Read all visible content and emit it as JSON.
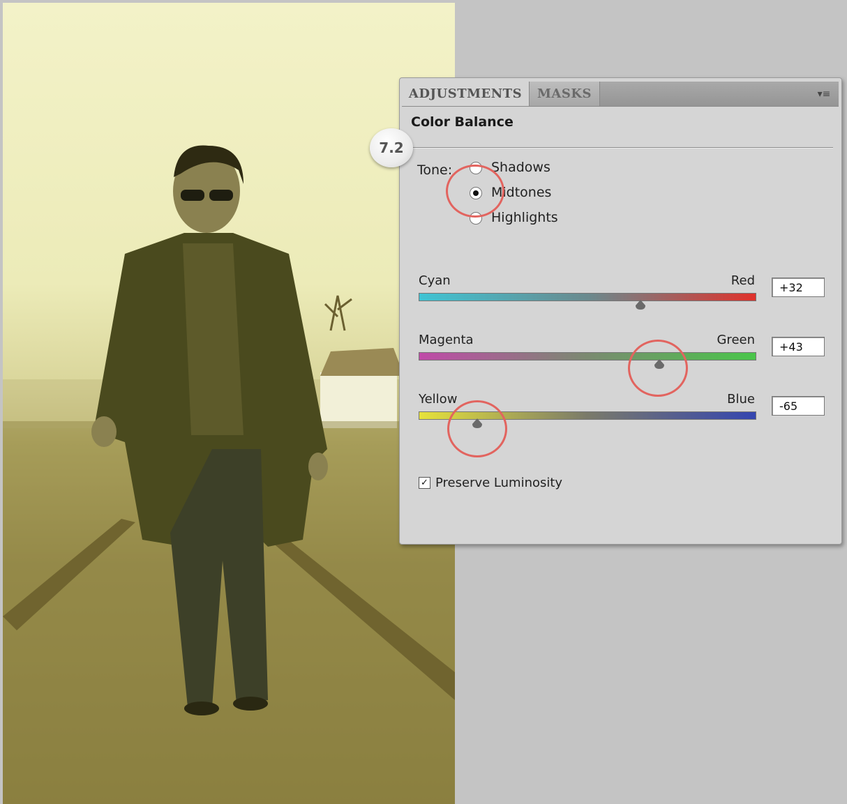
{
  "panel": {
    "tabs": [
      {
        "label": "ADJUSTMENTS",
        "active": true
      },
      {
        "label": "MASKS",
        "active": false
      }
    ],
    "menu_icon": "panel-menu-icon",
    "title": "Color Balance",
    "step_badge": "7.2"
  },
  "tone": {
    "label": "Tone:",
    "options": [
      {
        "label": "Shadows",
        "selected": false
      },
      {
        "label": "Midtones",
        "selected": true
      },
      {
        "label": "Highlights",
        "selected": false
      }
    ]
  },
  "sliders": [
    {
      "left": "Cyan",
      "right": "Red",
      "value": "+32",
      "numeric": 32,
      "gradient": [
        "#3fc4d4",
        "#6a8a8e",
        "#e0322c"
      ]
    },
    {
      "left": "Magenta",
      "right": "Green",
      "value": "+43",
      "numeric": 43,
      "gradient": [
        "#c04aa8",
        "#7a8a70",
        "#49c64a"
      ]
    },
    {
      "left": "Yellow",
      "right": "Blue",
      "value": "-65",
      "numeric": -65,
      "gradient": [
        "#e6e23a",
        "#7a7a6a",
        "#3445b0"
      ]
    }
  ],
  "preserve_luminosity": {
    "label": "Preserve Luminosity",
    "checked": true
  },
  "colors": {
    "panel_bg": "#d5d5d5",
    "highlight_ring": "#e2645f",
    "canvas_bg": "#c4c4c4"
  }
}
